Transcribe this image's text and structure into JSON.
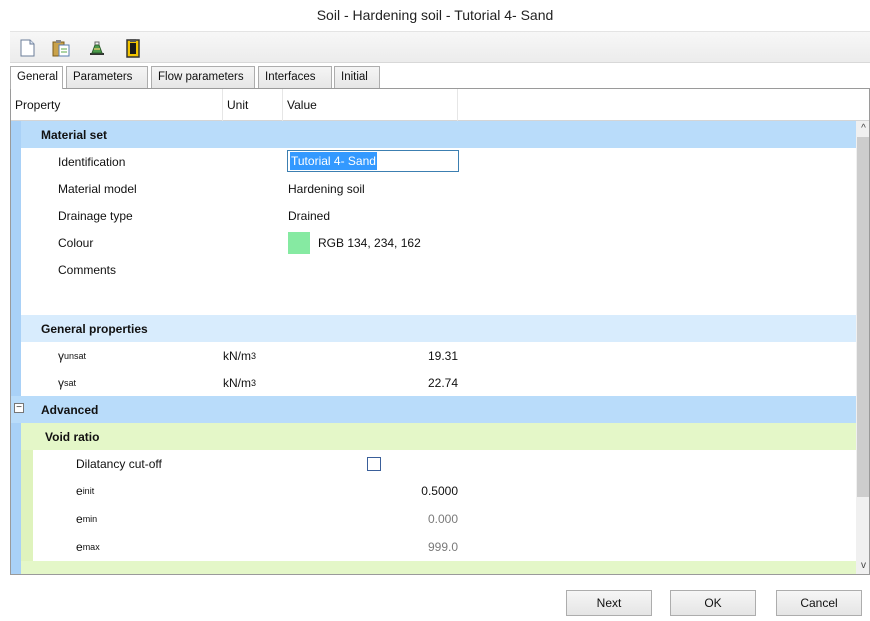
{
  "window": {
    "title": "Soil - Hardening soil - Tutorial 4- Sand"
  },
  "toolbar": {
    "icons": [
      "new-document-icon",
      "paste-icon",
      "soil-sample-icon",
      "clipboard-icon"
    ]
  },
  "tabs": [
    {
      "label": "General",
      "active": true
    },
    {
      "label": "Parameters"
    },
    {
      "label": "Flow parameters"
    },
    {
      "label": "Interfaces"
    },
    {
      "label": "Initial"
    }
  ],
  "columns": {
    "property": "Property",
    "unit": "Unit",
    "value": "Value"
  },
  "material_set": {
    "label": "Material set",
    "identification": {
      "label": "Identification",
      "value": "Tutorial 4- Sand"
    },
    "material_model": {
      "label": "Material model",
      "value": "Hardening soil"
    },
    "drainage_type": {
      "label": "Drainage type",
      "value": "Drained"
    },
    "colour": {
      "label": "Colour",
      "value": "RGB 134, 234, 162",
      "swatch": "#86eaa2"
    },
    "comments": {
      "label": "Comments"
    }
  },
  "general_properties": {
    "label": "General properties",
    "gamma_unsat": {
      "symbol": "γ",
      "sub": "unsat",
      "unit": "kN/m",
      "unit_sup": "3",
      "value": "19.31"
    },
    "gamma_sat": {
      "symbol": "γ",
      "sub": "sat",
      "unit": "kN/m",
      "unit_sup": "3",
      "value": "22.74"
    }
  },
  "advanced": {
    "label": "Advanced",
    "expander": "−",
    "void_ratio": {
      "label": "Void ratio",
      "dilatancy": {
        "label": "Dilatancy cut-off",
        "checked": false
      },
      "e_init": {
        "symbol": "e",
        "sub": "init",
        "value": "0.5000"
      },
      "e_min": {
        "symbol": "e",
        "sub": "min",
        "value": "0.000"
      },
      "e_max": {
        "symbol": "e",
        "sub": "max",
        "value": "999.0"
      }
    }
  },
  "buttons": {
    "next": "Next",
    "ok": "OK",
    "cancel": "Cancel"
  },
  "scrollbar": {
    "up": "^",
    "down": "v"
  }
}
